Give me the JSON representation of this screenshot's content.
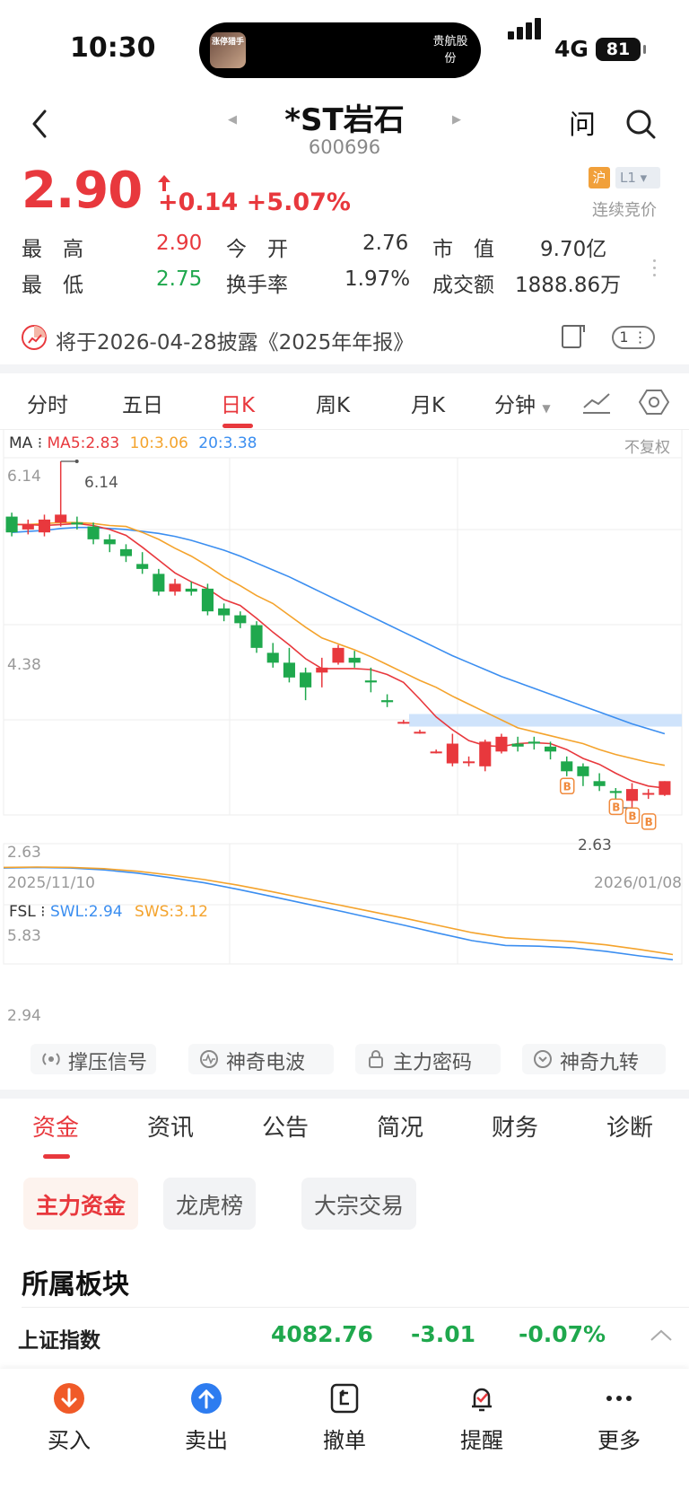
{
  "status_bar": {
    "time": "10:30",
    "network": "4G",
    "battery": "81",
    "island_avatar_text": "涨停猎手",
    "island_text": "贵航股份"
  },
  "header": {
    "title": "*ST岩石",
    "code": "600696",
    "ask_label": "问"
  },
  "quote": {
    "price": "2.90",
    "change": "+0.14",
    "change_pct": "+5.07%",
    "tag_exchange": "沪",
    "tag_level": "L1",
    "auction": "连续竞价",
    "stats": [
      {
        "label": "最　高",
        "value": "2.90"
      },
      {
        "label": "今　开",
        "value": "2.76"
      },
      {
        "label": "市　值",
        "value": "9.70亿"
      },
      {
        "label": "最　低",
        "value": "2.75"
      },
      {
        "label": "换手率",
        "value": "1.97%"
      },
      {
        "label": "成交额",
        "value": "1888.86万"
      }
    ]
  },
  "notice": {
    "text": "将于2026-04-28披露《2025年年报》",
    "count": "1"
  },
  "period_tabs": [
    "分时",
    "五日",
    "日K",
    "周K",
    "月K",
    "分钟"
  ],
  "chart_data": [
    {
      "type": "candlestick",
      "title": "",
      "legend": {
        "name": "MA",
        "ma5": "MA5:2.83",
        "ma10": "10:3.06",
        "ma20": "20:3.38"
      },
      "adjust_label": "不复权",
      "y_labels": [
        "6.14",
        "4.38",
        "2.63"
      ],
      "max_marker": "6.14",
      "min_marker": "2.63",
      "x_labels": [
        "2025/11/10",
        "2026/01/08"
      ],
      "ylim": [
        2.63,
        6.14
      ],
      "candles": [
        [
          5.58,
          5.42,
          5.62,
          5.38
        ],
        [
          5.45,
          5.5,
          5.55,
          5.4
        ],
        [
          5.42,
          5.55,
          5.6,
          5.38
        ],
        [
          5.52,
          5.6,
          6.14,
          5.48
        ],
        [
          5.52,
          5.5,
          5.58,
          5.45
        ],
        [
          5.48,
          5.35,
          5.52,
          5.3
        ],
        [
          5.35,
          5.3,
          5.4,
          5.22
        ],
        [
          5.25,
          5.18,
          5.3,
          5.12
        ],
        [
          5.1,
          5.05,
          5.22,
          5.0
        ],
        [
          5.0,
          4.82,
          5.05,
          4.78
        ],
        [
          4.82,
          4.9,
          4.95,
          4.78
        ],
        [
          4.85,
          4.82,
          4.92,
          4.78
        ],
        [
          4.85,
          4.62,
          4.9,
          4.58
        ],
        [
          4.65,
          4.58,
          4.7,
          4.52
        ],
        [
          4.58,
          4.5,
          4.62,
          4.45
        ],
        [
          4.48,
          4.25,
          4.52,
          4.2
        ],
        [
          4.2,
          4.1,
          4.3,
          4.05
        ],
        [
          4.1,
          3.95,
          4.25,
          3.9
        ],
        [
          4.0,
          3.85,
          4.05,
          3.72
        ],
        [
          4.0,
          4.05,
          4.15,
          3.85
        ],
        [
          4.1,
          4.25,
          4.28,
          4.08
        ],
        [
          4.15,
          4.1,
          4.22,
          4.05
        ],
        [
          3.92,
          3.9,
          4.05,
          3.8
        ],
        [
          3.72,
          3.7,
          3.78,
          3.65
        ],
        [
          3.5,
          3.5,
          3.52,
          3.48
        ],
        [
          3.4,
          3.4,
          3.42,
          3.38
        ],
        [
          3.2,
          3.2,
          3.22,
          3.18
        ],
        [
          3.08,
          3.28,
          3.38,
          3.05
        ],
        [
          3.1,
          3.1,
          3.15,
          3.05
        ],
        [
          3.05,
          3.3,
          3.32,
          3.0
        ],
        [
          3.2,
          3.35,
          3.38,
          3.18
        ],
        [
          3.28,
          3.25,
          3.35,
          3.2
        ],
        [
          3.3,
          3.28,
          3.35,
          3.22
        ],
        [
          3.25,
          3.2,
          3.3,
          3.12
        ],
        [
          3.1,
          3.0,
          3.15,
          2.95
        ],
        [
          3.05,
          2.95,
          3.08,
          2.85
        ],
        [
          2.9,
          2.85,
          2.98,
          2.8
        ],
        [
          2.8,
          2.78,
          2.83,
          2.72
        ],
        [
          2.7,
          2.82,
          2.88,
          2.63
        ],
        [
          2.78,
          2.78,
          2.82,
          2.72
        ],
        [
          2.76,
          2.9,
          2.9,
          2.75
        ]
      ],
      "b_markers": [
        "B",
        "B",
        "B",
        "B"
      ],
      "ma5": [
        5.5,
        5.5,
        5.49,
        5.5,
        5.51,
        5.49,
        5.45,
        5.39,
        5.27,
        5.14,
        5.01,
        4.92,
        4.85,
        4.74,
        4.68,
        4.55,
        4.41,
        4.28,
        4.14,
        4.04,
        4.04,
        4.04,
        4.03,
        3.98,
        3.9,
        3.73,
        3.55,
        3.42,
        3.31,
        3.26,
        3.25,
        3.28,
        3.29,
        3.28,
        3.22,
        3.13,
        3.07,
        2.98,
        2.9,
        2.85,
        2.83
      ],
      "ma10": [
        5.5,
        5.5,
        5.51,
        5.52,
        5.52,
        5.51,
        5.49,
        5.48,
        5.42,
        5.35,
        5.26,
        5.18,
        5.08,
        4.97,
        4.88,
        4.78,
        4.7,
        4.58,
        4.46,
        4.35,
        4.29,
        4.23,
        4.16,
        4.08,
        4.0,
        3.92,
        3.85,
        3.76,
        3.68,
        3.6,
        3.52,
        3.44,
        3.4,
        3.36,
        3.32,
        3.28,
        3.22,
        3.17,
        3.13,
        3.09,
        3.06
      ],
      "ma20": [
        5.42,
        5.43,
        5.44,
        5.46,
        5.47,
        5.47,
        5.46,
        5.45,
        5.43,
        5.41,
        5.38,
        5.34,
        5.29,
        5.24,
        5.18,
        5.11,
        5.04,
        4.97,
        4.89,
        4.81,
        4.73,
        4.65,
        4.57,
        4.49,
        4.41,
        4.33,
        4.25,
        4.17,
        4.1,
        4.03,
        3.96,
        3.9,
        3.84,
        3.78,
        3.72,
        3.66,
        3.6,
        3.54,
        3.48,
        3.43,
        3.38
      ]
    },
    {
      "type": "line",
      "title": "",
      "legend": {
        "name": "FSL",
        "swl": "SWL:2.94",
        "sws": "SWS:3.12"
      },
      "y_labels": [
        "5.83",
        "2.94"
      ],
      "ylim": [
        2.94,
        5.83
      ],
      "series": [
        {
          "name": "SWL",
          "values": [
            5.8,
            5.82,
            5.8,
            5.74,
            5.64,
            5.5,
            5.34,
            5.14,
            4.92,
            4.7,
            4.48,
            4.25,
            4.02,
            3.78,
            3.55,
            3.4,
            3.38,
            3.33,
            3.22,
            3.08,
            2.96
          ]
        },
        {
          "name": "SWS",
          "values": [
            5.82,
            5.83,
            5.82,
            5.78,
            5.7,
            5.58,
            5.44,
            5.27,
            5.07,
            4.86,
            4.66,
            4.45,
            4.24,
            4.02,
            3.8,
            3.64,
            3.58,
            3.52,
            3.42,
            3.28,
            3.12
          ]
        }
      ]
    }
  ],
  "indicator_buttons": [
    "撑压信号",
    "神奇电波",
    "主力密码",
    "神奇九转"
  ],
  "info_tabs": [
    "资金",
    "资讯",
    "公告",
    "简况",
    "财务",
    "诊断"
  ],
  "fund_chips": [
    "主力资金",
    "龙虎榜",
    "大宗交易"
  ],
  "sector": {
    "title": "所属板块",
    "index_name": "上证指数",
    "index_value": "4082.76",
    "index_change": "-3.01",
    "index_pct": "-0.07%"
  },
  "bottom_nav": [
    "买入",
    "卖出",
    "撤单",
    "提醒",
    "更多"
  ],
  "colors": {
    "up": "#e8383d",
    "down": "#1fa84d",
    "ma5": "#e8383d",
    "ma10": "#f4a32c",
    "ma20": "#3b8ef0",
    "b_marker": "#f08a3c"
  }
}
